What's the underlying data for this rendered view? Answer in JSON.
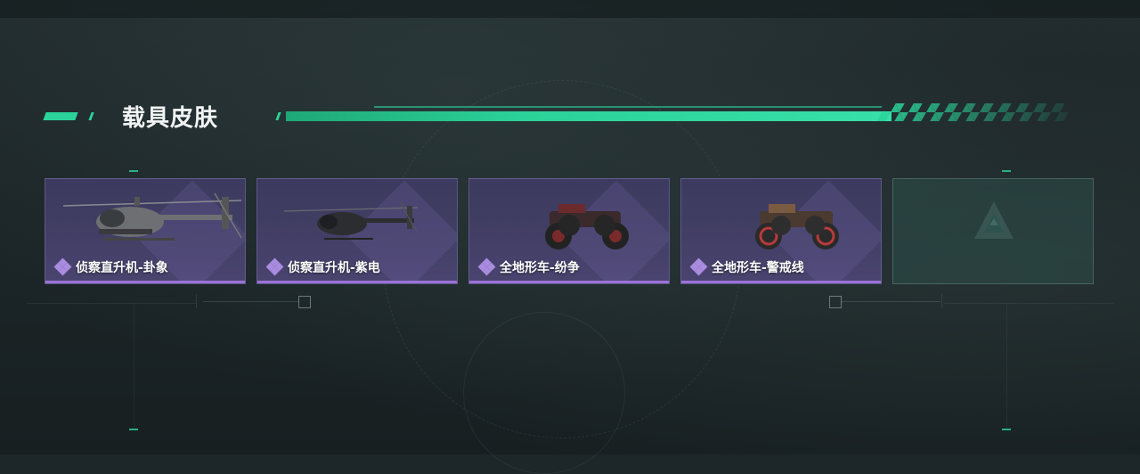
{
  "section": {
    "title": "载具皮肤"
  },
  "cards": [
    {
      "name": "侦察直升机-卦象",
      "vehicle": "helicopter-icon",
      "rarity": "epic"
    },
    {
      "name": "侦察直升机-紫电",
      "vehicle": "helicopter-icon",
      "rarity": "epic"
    },
    {
      "name": "全地形车-纷争",
      "vehicle": "atv-icon",
      "rarity": "epic"
    },
    {
      "name": "全地形车-警戒线",
      "vehicle": "atv-icon",
      "rarity": "epic"
    }
  ],
  "empty_slot": {
    "icon": "game-logo-icon"
  },
  "colors": {
    "accent": "#2bd39a",
    "card_bg": "#433f66",
    "rarity": "#9b72d6"
  }
}
